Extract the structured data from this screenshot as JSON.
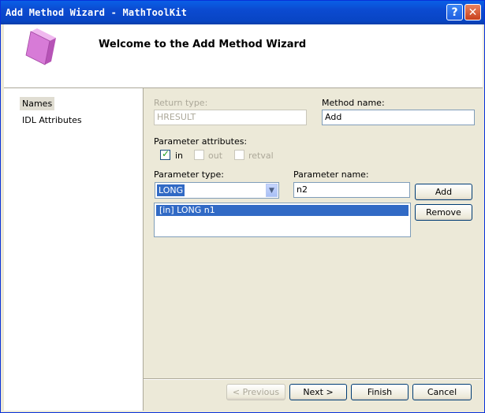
{
  "window": {
    "title": "Add Method Wizard - MathToolKit",
    "help_button": "?",
    "close_button": "✕"
  },
  "header": {
    "title": "Welcome to the Add Method Wizard",
    "logo_icon": "pink-cube-icon"
  },
  "nav": {
    "items": [
      {
        "label": "Names",
        "selected": true
      },
      {
        "label": "IDL Attributes",
        "selected": false
      }
    ]
  },
  "form": {
    "return_type": {
      "label": "Return type:",
      "value": "HRESULT",
      "enabled": false
    },
    "method_name": {
      "label": "Method name:",
      "value": "Add"
    },
    "param_attrs": {
      "label": "Parameter attributes:",
      "in": {
        "label": "in",
        "checked": true,
        "enabled": true
      },
      "out": {
        "label": "out",
        "checked": false,
        "enabled": false
      },
      "retval": {
        "label": "retval",
        "checked": false,
        "enabled": false
      }
    },
    "param_type": {
      "label": "Parameter type:",
      "value": "LONG"
    },
    "param_name": {
      "label": "Parameter name:",
      "value": "n2"
    },
    "add_button": "Add",
    "remove_button": "Remove",
    "param_list": [
      "[in] LONG n1"
    ]
  },
  "footer": {
    "previous": "< Previous",
    "next": "Next >",
    "finish": "Finish",
    "cancel": "Cancel"
  }
}
